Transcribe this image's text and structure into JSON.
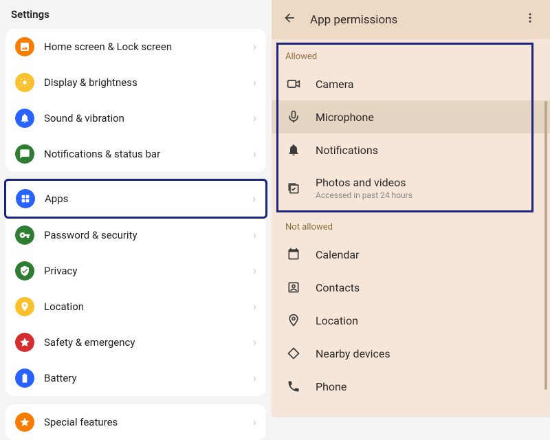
{
  "settings": {
    "header": "Settings",
    "groups": [
      {
        "items": [
          {
            "label": "Home screen & Lock screen",
            "icon": "home",
            "color": "#f57c00"
          },
          {
            "label": "Display & brightness",
            "icon": "brightness",
            "color": "#fbc02d"
          },
          {
            "label": "Sound & vibration",
            "icon": "sound",
            "color": "#2962ff"
          },
          {
            "label": "Notifications & status bar",
            "icon": "notifications",
            "color": "#2e7d32"
          }
        ]
      },
      {
        "items": [
          {
            "label": "Apps",
            "icon": "apps",
            "color": "#2962ff",
            "highlighted": true
          },
          {
            "label": "Password & security",
            "icon": "security",
            "color": "#2e7d32"
          },
          {
            "label": "Privacy",
            "icon": "privacy",
            "color": "#2e7d32"
          },
          {
            "label": "Location",
            "icon": "location",
            "color": "#fbc02d"
          },
          {
            "label": "Safety & emergency",
            "icon": "emergency",
            "color": "#d32f2f"
          },
          {
            "label": "Battery",
            "icon": "battery",
            "color": "#2962ff"
          }
        ]
      },
      {
        "items": [
          {
            "label": "Special features",
            "icon": "star",
            "color": "#f57c00"
          }
        ]
      }
    ]
  },
  "permissions": {
    "title": "App permissions",
    "allowed_label": "Allowed",
    "not_allowed_label": "Not allowed",
    "allowed": [
      {
        "label": "Camera",
        "icon": "camera"
      },
      {
        "label": "Microphone",
        "icon": "mic",
        "selected": true
      },
      {
        "label": "Notifications",
        "icon": "bell"
      },
      {
        "label": "Photos and videos",
        "icon": "photos",
        "sub": "Accessed in past 24 hours"
      }
    ],
    "not_allowed": [
      {
        "label": "Calendar",
        "icon": "calendar"
      },
      {
        "label": "Contacts",
        "icon": "contacts"
      },
      {
        "label": "Location",
        "icon": "location-pin"
      },
      {
        "label": "Nearby devices",
        "icon": "nearby"
      },
      {
        "label": "Phone",
        "icon": "phone"
      }
    ]
  }
}
